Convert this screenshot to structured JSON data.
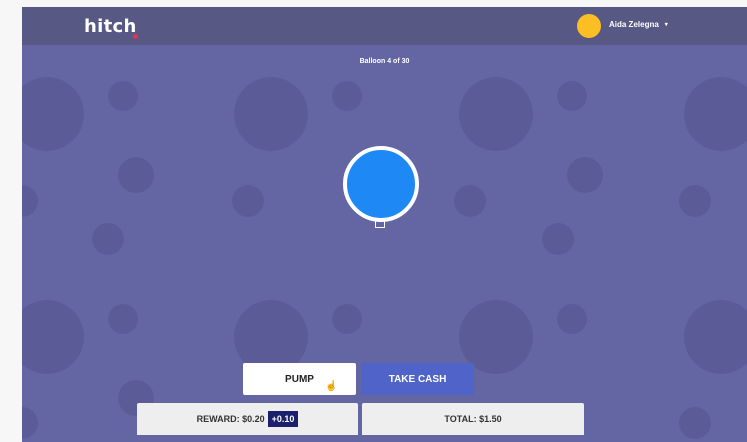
{
  "header": {
    "logo_text": "hitch",
    "user_name": "Aida Zelegna",
    "caret": "▾"
  },
  "game": {
    "counter": "Balloon 4 of 30",
    "pump_label": "PUMP",
    "take_cash_label": "TAKE CASH",
    "reward_label": "REWARD: $0.20",
    "reward_bonus": "+0.10",
    "total_label": "TOTAL: $1.50"
  },
  "colors": {
    "background": "#6466a4",
    "topbar": "#575883",
    "balloon": "#1e88f5",
    "take_cash_button": "#4f63c9",
    "bonus_badge": "#1a1f6e",
    "avatar": "#fbbf24"
  }
}
